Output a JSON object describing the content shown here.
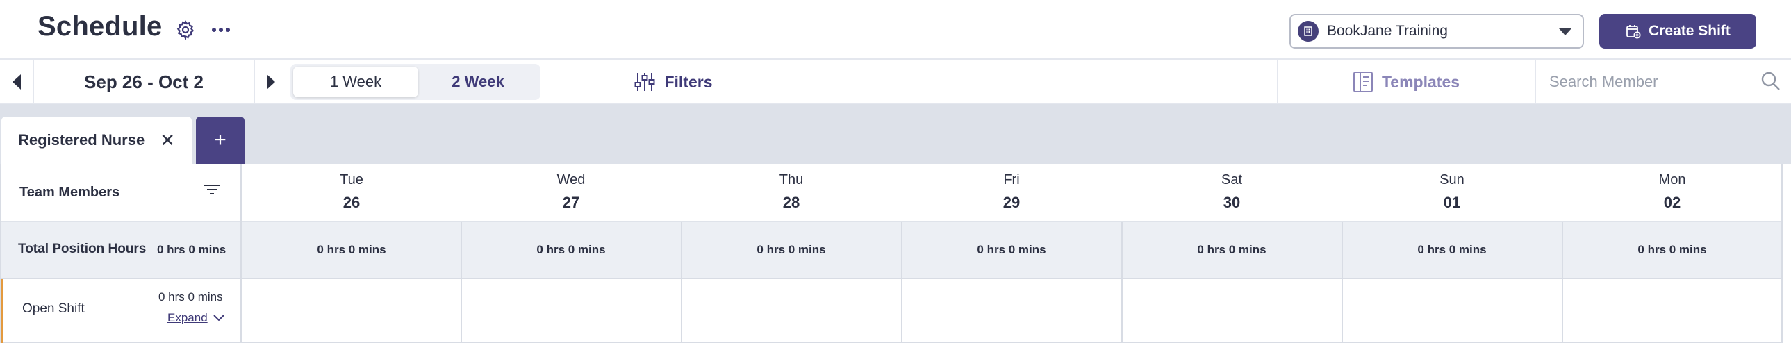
{
  "header": {
    "title": "Schedule",
    "location": "BookJane Training",
    "create_shift_label": "Create Shift"
  },
  "toolbar": {
    "date_range": "Sep 26 - Oct 2",
    "week_options": [
      "1 Week",
      "2 Week"
    ],
    "selected_week": "1 Week",
    "filters_label": "Filters",
    "templates_label": "Templates",
    "search_placeholder": "Search Member"
  },
  "tabs": {
    "items": [
      {
        "label": "Registered Nurse",
        "active": true
      }
    ],
    "add_label": "+"
  },
  "grid": {
    "team_members_label": "Team Members",
    "days": [
      {
        "name": "Tue",
        "date": "26"
      },
      {
        "name": "Wed",
        "date": "27"
      },
      {
        "name": "Thu",
        "date": "28"
      },
      {
        "name": "Fri",
        "date": "29"
      },
      {
        "name": "Sat",
        "date": "30"
      },
      {
        "name": "Sun",
        "date": "01"
      },
      {
        "name": "Mon",
        "date": "02"
      }
    ],
    "totals": {
      "label": "Total Position Hours",
      "total": "0 hrs 0 mins",
      "daily": [
        "0 hrs 0 mins",
        "0 hrs 0 mins",
        "0 hrs 0 mins",
        "0 hrs 0 mins",
        "0 hrs 0 mins",
        "0 hrs 0 mins",
        "0 hrs 0 mins"
      ]
    },
    "open_shift": {
      "label": "Open Shift",
      "hours": "0 hrs 0 mins",
      "expand_label": "Expand"
    }
  },
  "colors": {
    "brand": "#4a4384",
    "open_shift_accent": "#e49a3e",
    "tab_strip": "#dde1e9",
    "totals_row": "#eceff4"
  }
}
